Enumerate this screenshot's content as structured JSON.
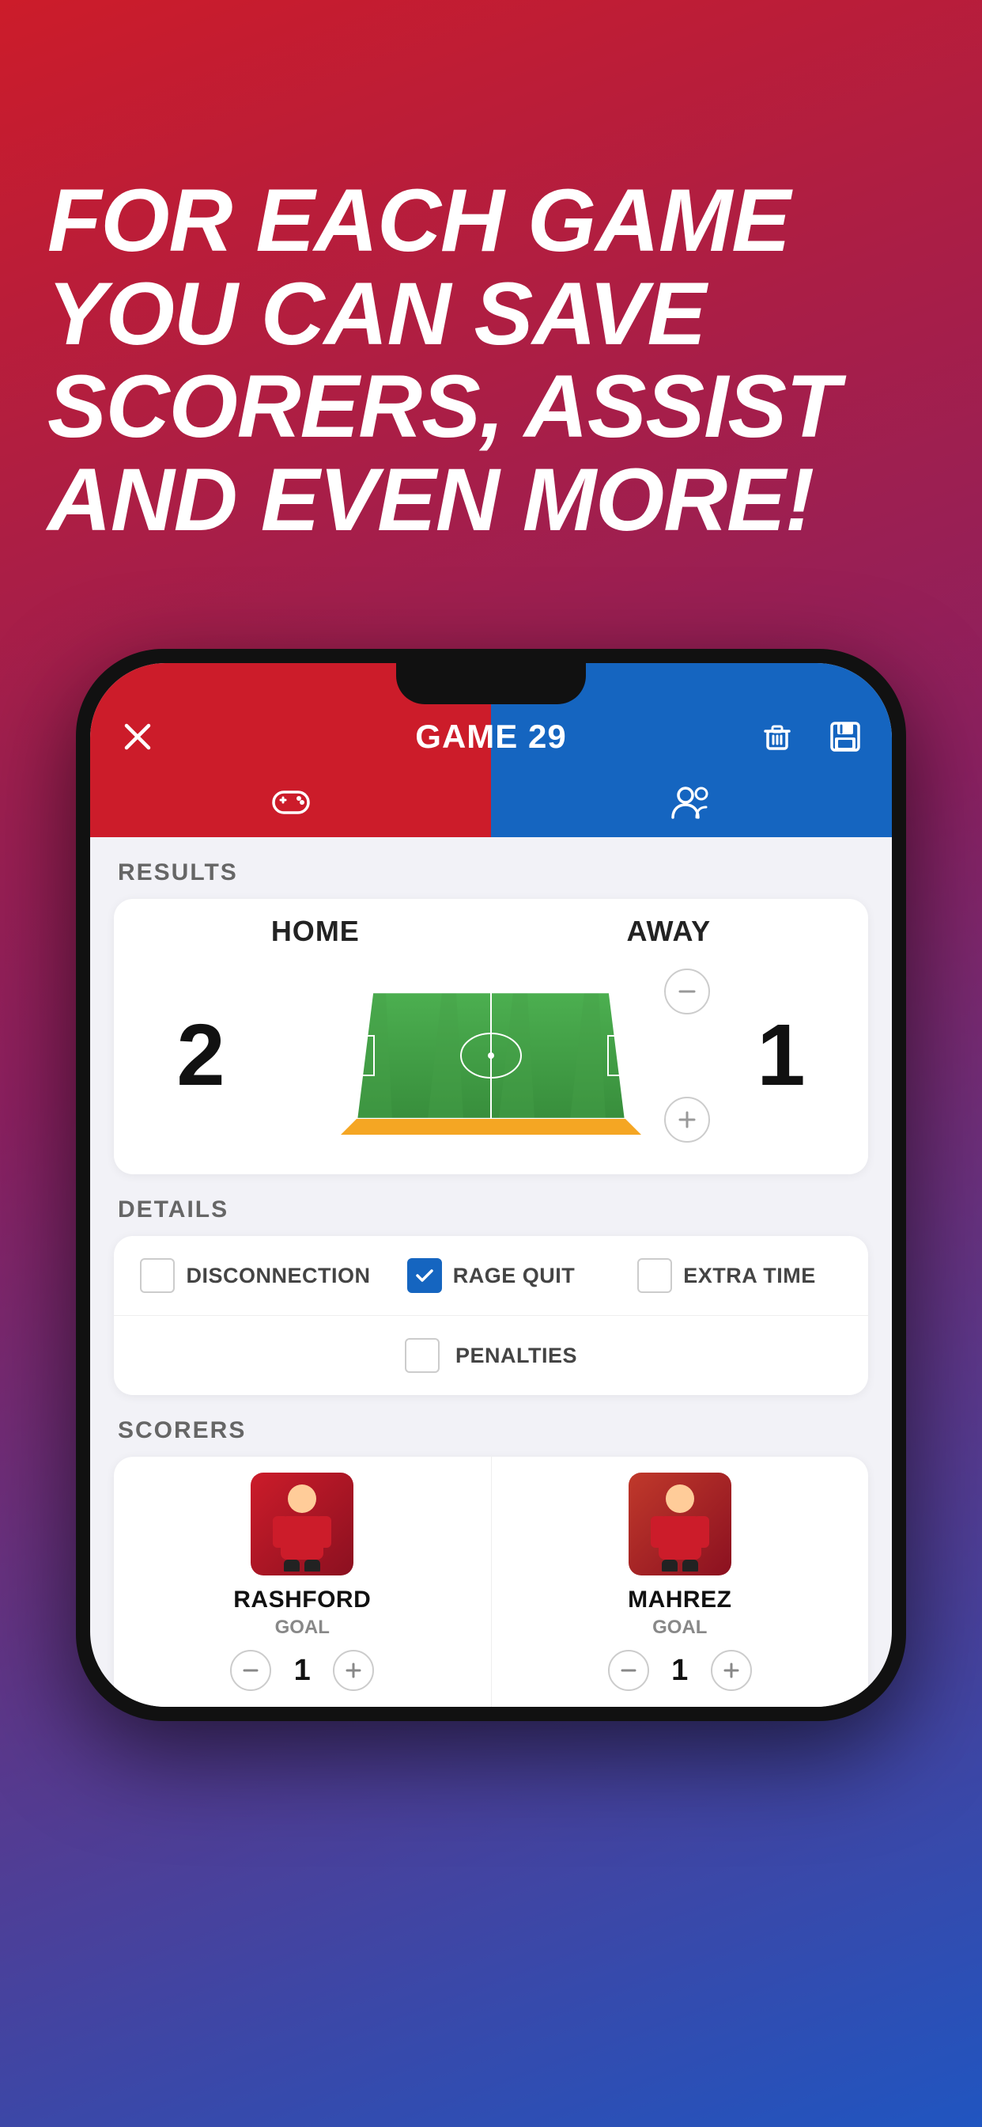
{
  "hero": {
    "text": "FOR EACH GAME YOU CAN SAVE SCORERS, ASSIST AND EVEN MORE!"
  },
  "phone": {
    "header": {
      "title": "GAME 29",
      "close_label": "×",
      "delete_icon": "trash-icon",
      "save_icon": "save-icon",
      "tab_left_icon": "gamepad-icon",
      "tab_right_icon": "players-icon"
    },
    "results": {
      "section_label": "RESULTS",
      "home_label": "HOME",
      "away_label": "AWAY",
      "home_score": "2",
      "away_score": "1"
    },
    "details": {
      "section_label": "DETAILS",
      "disconnection_label": "DISCONNECTION",
      "disconnection_checked": false,
      "rage_quit_label": "RAGE QUIT",
      "rage_quit_checked": true,
      "extra_time_label": "EXTRA TIME",
      "extra_time_checked": false,
      "penalties_label": "PENALTIES",
      "penalties_checked": false
    },
    "scorers": {
      "section_label": "SCORERS",
      "items": [
        {
          "name": "RASHFORD",
          "type": "GOAL",
          "count": "1"
        },
        {
          "name": "MAHREZ",
          "type": "GOAL",
          "count": "1"
        }
      ]
    }
  },
  "colors": {
    "red": "#cc1c2a",
    "blue": "#1565c0",
    "checked_blue": "#1565c0"
  }
}
